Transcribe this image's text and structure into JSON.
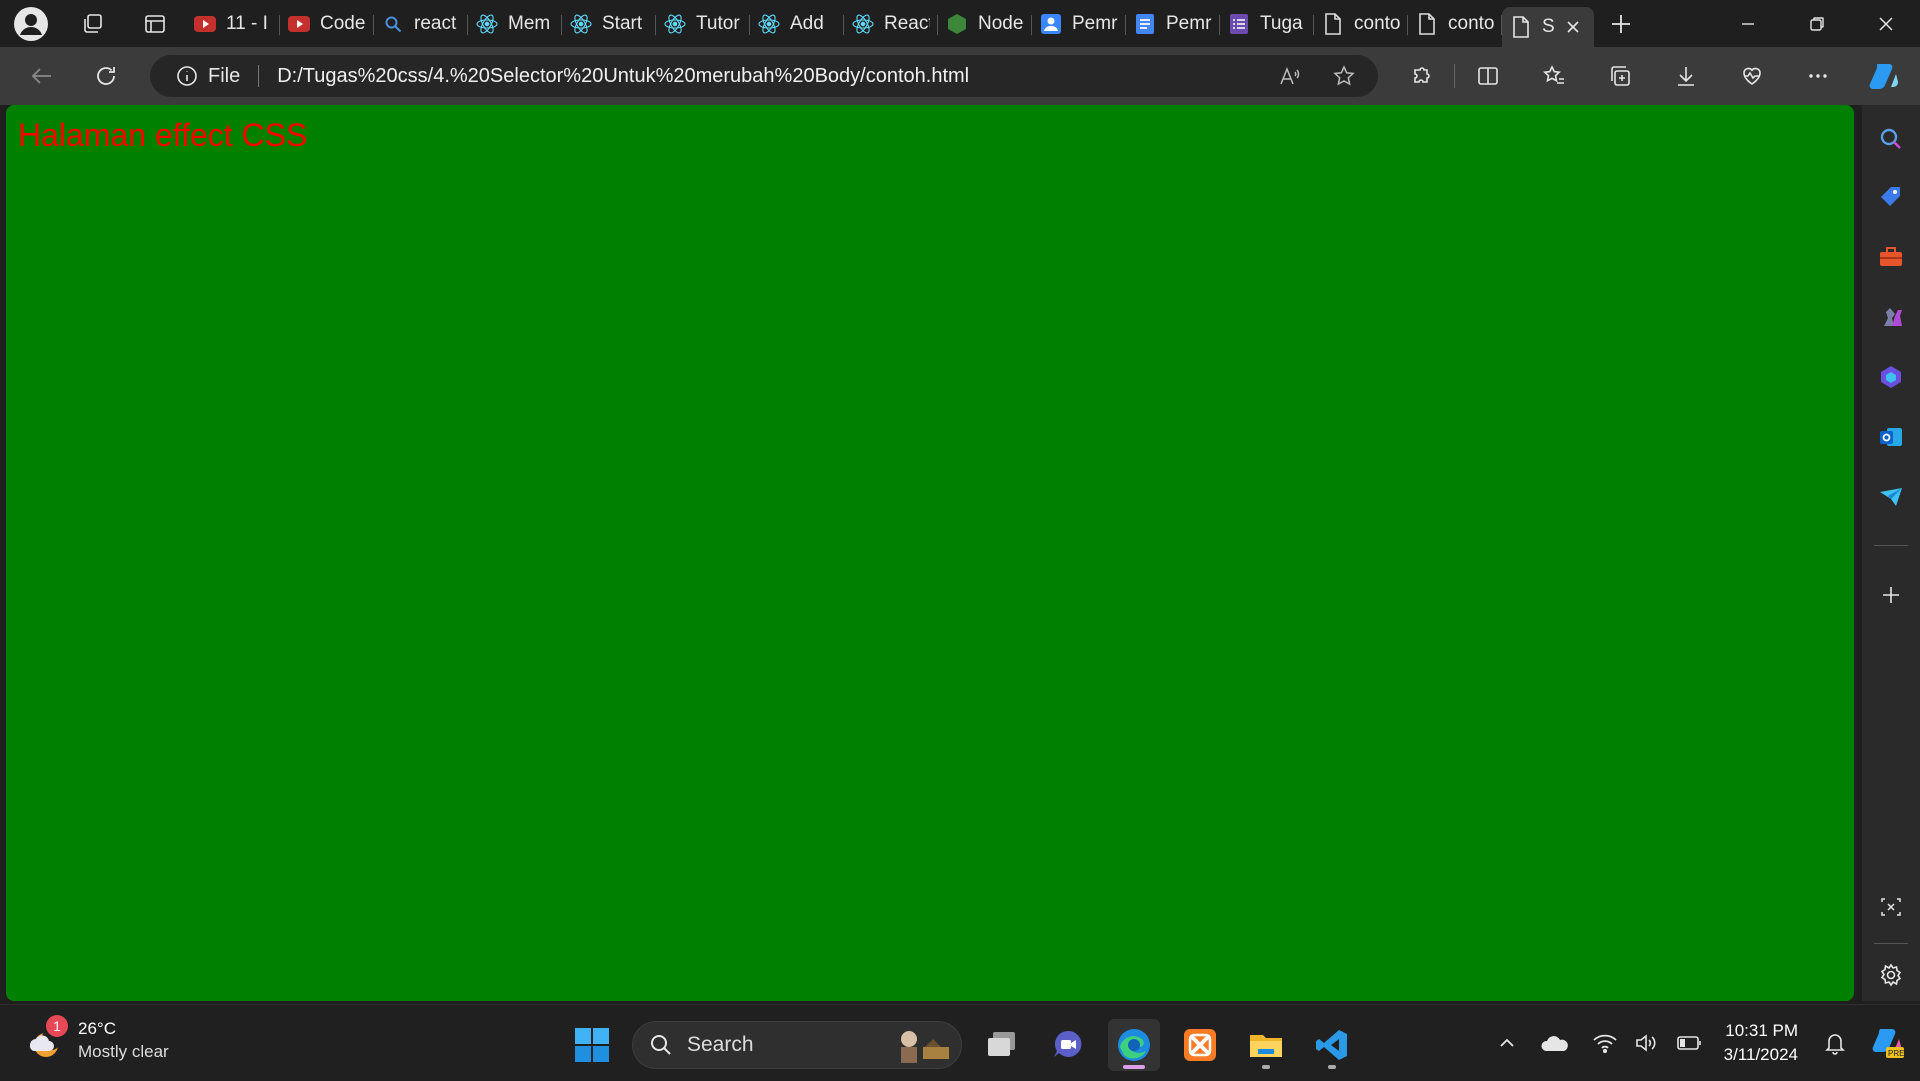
{
  "tabs": [
    {
      "label": "11 - I",
      "icon": "youtube-icon",
      "color": "#c4302b"
    },
    {
      "label": "Code",
      "icon": "youtube-icon",
      "color": "#c4302b"
    },
    {
      "label": "react",
      "icon": "search-icon",
      "color": "#4a90d9"
    },
    {
      "label": "Mem",
      "icon": "react-icon",
      "color": "#61dafb"
    },
    {
      "label": "Start",
      "icon": "react-icon",
      "color": "#61dafb"
    },
    {
      "label": "Tutor",
      "icon": "react-icon",
      "color": "#61dafb"
    },
    {
      "label": "Add",
      "icon": "react-icon",
      "color": "#61dafb"
    },
    {
      "label": "React",
      "icon": "react-icon",
      "color": "#61dafb"
    },
    {
      "label": "Node",
      "icon": "nodejs-icon",
      "color": "#3c873a"
    },
    {
      "label": "Pemr",
      "icon": "contacts-icon",
      "color": "#3a86ff"
    },
    {
      "label": "Pemr",
      "icon": "docs-icon",
      "color": "#4285f4"
    },
    {
      "label": "Tuga",
      "icon": "forms-icon",
      "color": "#6a4caf"
    },
    {
      "label": "conto",
      "icon": "file-icon",
      "color": "#dddddd"
    },
    {
      "label": "conto",
      "icon": "file-icon",
      "color": "#dddddd"
    }
  ],
  "active_tab": {
    "label": "S",
    "icon": "file-icon"
  },
  "address": {
    "scheme_label": "File",
    "url": "D:/Tugas%20css/4.%20Selector%20Untuk%20merubah%20Body/contoh.html"
  },
  "page": {
    "heading": "Halaman effect CSS",
    "background": "#008000",
    "heading_color": "#ff0000"
  },
  "taskbar": {
    "weather_temp": "26°C",
    "weather_desc": "Mostly clear",
    "weather_badge": "1",
    "search_label": "Search",
    "time": "10:31 PM",
    "date": "3/11/2024"
  }
}
